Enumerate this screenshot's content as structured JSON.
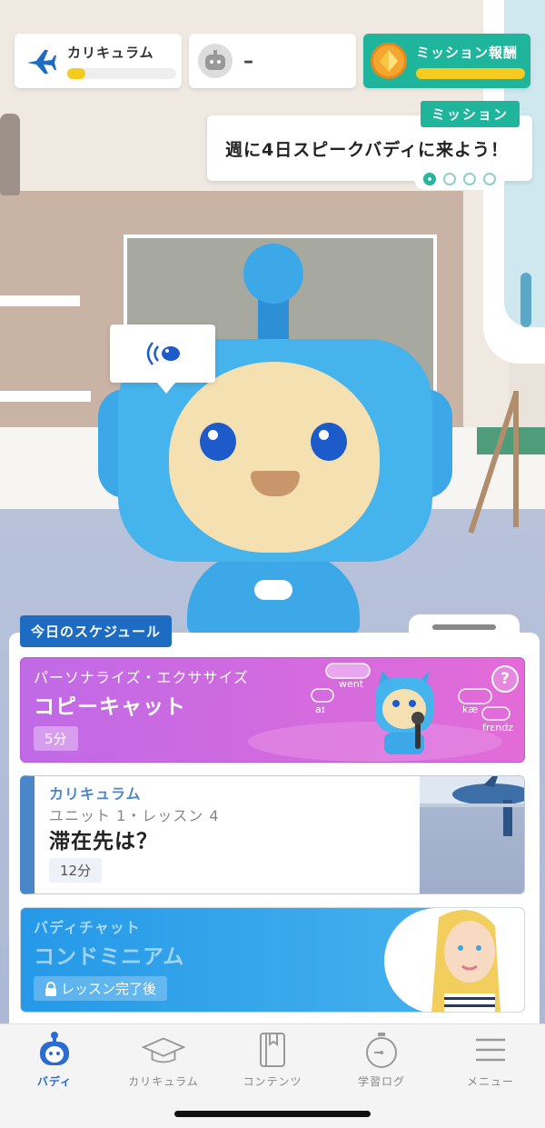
{
  "status_bar": {
    "curriculum": {
      "label": "カリキュラム",
      "progress": 0.17,
      "icon": "airplane-icon"
    },
    "buddy": {
      "value": "–",
      "icon": "robot-avatar-icon"
    },
    "mission_reward": {
      "label": "ミッション報酬",
      "progress": 1.0,
      "icon": "medal-icon"
    }
  },
  "mission_bubble": {
    "tag": "ミッション",
    "text": "週に4日スピークバディに来よう！",
    "pages": 4,
    "active_page": 1
  },
  "schedule": {
    "tab_label": "今日のスケジュール",
    "cards": [
      {
        "subtitle": "パーソナライズ・エクササイズ",
        "title": "コピーキャット",
        "duration": "5分",
        "help": "?",
        "words": [
          "went",
          "aɪ",
          "kæ",
          "frɛndz"
        ],
        "accent": "#c86ae4"
      },
      {
        "category": "カリキュラム",
        "unit": "ユニット 1・レッスン 4",
        "title": "滞在先は？",
        "duration": "12分",
        "accent": "#4a86c8"
      },
      {
        "subtitle": "バディチャット",
        "title": "コンドミニアム",
        "lock_label": "レッスン完了後",
        "accent": "#2599e8"
      }
    ]
  },
  "nav": {
    "items": [
      {
        "label": "バディ",
        "icon": "buddy-icon",
        "active": true
      },
      {
        "label": "カリキュラム",
        "icon": "graduation-cap-icon",
        "active": false
      },
      {
        "label": "コンテンツ",
        "icon": "book-icon",
        "active": false
      },
      {
        "label": "学習ログ",
        "icon": "stopwatch-icon",
        "active": false
      },
      {
        "label": "メニュー",
        "icon": "menu-icon",
        "active": false
      }
    ]
  }
}
